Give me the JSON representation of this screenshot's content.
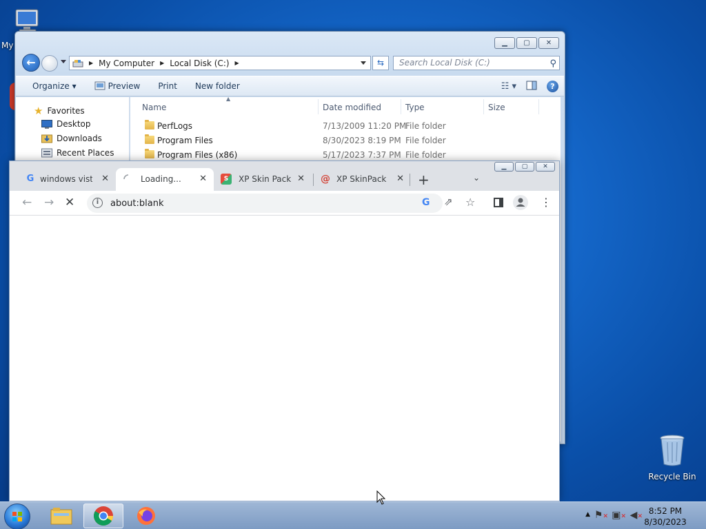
{
  "desktop": {
    "icons": [
      {
        "name": "my-computer",
        "label": "My"
      },
      {
        "name": "recycle-bin",
        "label": "Recycle Bin"
      }
    ]
  },
  "explorer": {
    "breadcrumb": [
      "My Computer",
      "Local Disk (C:)"
    ],
    "search_placeholder": "Search Local Disk (C:)",
    "toolbar": {
      "organize": "Organize",
      "preview": "Preview",
      "print": "Print",
      "new_folder": "New folder"
    },
    "nav": [
      {
        "label": "Favorites",
        "icon": "star-icon"
      },
      {
        "label": "Desktop",
        "icon": "desktop-icon"
      },
      {
        "label": "Downloads",
        "icon": "downloads-icon"
      },
      {
        "label": "Recent Places",
        "icon": "recent-places-icon"
      }
    ],
    "columns": {
      "name": "Name",
      "date": "Date modified",
      "type": "Type",
      "size": "Size"
    },
    "files": [
      {
        "name": "PerfLogs",
        "date": "7/13/2009 11:20 PM",
        "type": "File folder"
      },
      {
        "name": "Program Files",
        "date": "8/30/2023 8:19 PM",
        "type": "File folder"
      },
      {
        "name": "Program Files (x86)",
        "date": "5/17/2023 7:37 PM",
        "type": "File folder"
      }
    ]
  },
  "chrome": {
    "tabs": [
      {
        "title": "windows vista",
        "icon": "google-icon",
        "close": "✕"
      },
      {
        "title": "Loading...",
        "icon": "loading-spinner-icon",
        "close": "✕",
        "active": true
      },
      {
        "title": "XP Skin Pack -",
        "icon": "skinpack-icon",
        "close": "✕"
      },
      {
        "title": "XP SkinPack",
        "icon": "skinpack-swirl-icon",
        "close": "✕"
      }
    ],
    "url": "about:blank"
  },
  "taskbar": {
    "apps": [
      "explorer-icon",
      "chrome-icon",
      "firefox-icon"
    ],
    "time": "8:52 PM",
    "date": "8/30/2023"
  },
  "colors": {
    "accent": "#1a73e8",
    "taskbar": "#8ea9cc",
    "desktop": "#1466c8"
  }
}
